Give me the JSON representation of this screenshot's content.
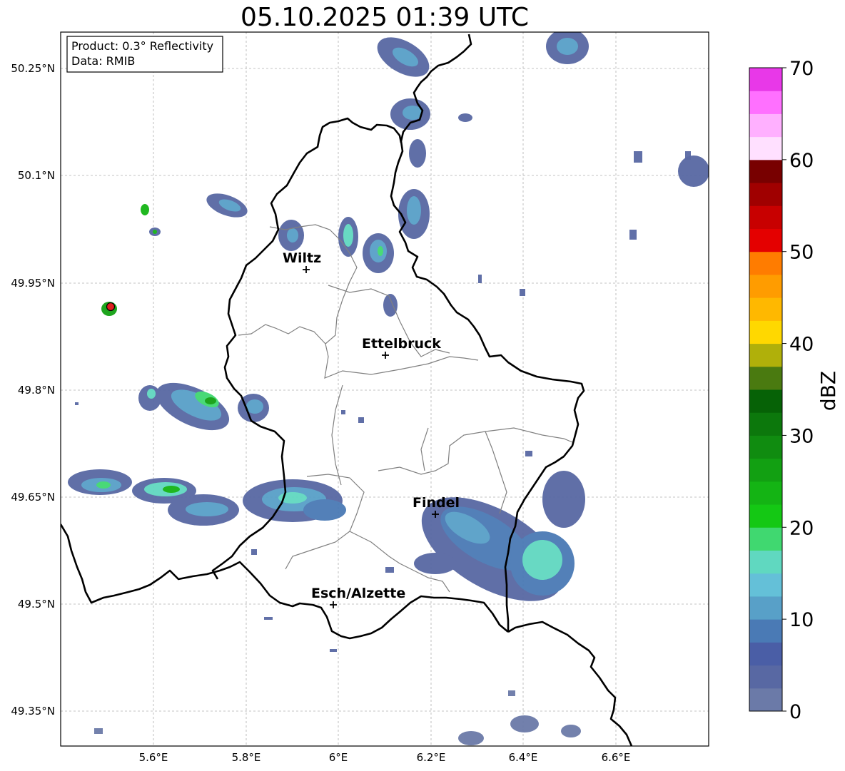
{
  "title": "05.10.2025 01:39 UTC",
  "info_box": {
    "product": "Product: 0.3° Reflectivity",
    "data_source": "Data: RMIB"
  },
  "axes": {
    "lon_ticks": [
      "5.6°E",
      "5.8°E",
      "6°E",
      "6.2°E",
      "6.4°E",
      "6.6°E"
    ],
    "lat_ticks": [
      "50.25°N",
      "50.1°N",
      "49.95°N",
      "49.8°N",
      "49.65°N",
      "49.5°N",
      "49.35°N"
    ]
  },
  "cities": [
    {
      "name": "Wiltz"
    },
    {
      "name": "Ettelbruck"
    },
    {
      "name": "Findel"
    },
    {
      "name": "Esch/Alzette"
    }
  ],
  "colorbar": {
    "title": "dBZ",
    "ticks": [
      "0",
      "10",
      "20",
      "30",
      "40",
      "50",
      "60",
      "70"
    ],
    "colors": [
      "#6b7aa8",
      "#5868a3",
      "#4a5ea6",
      "#4a7ab5",
      "#58a0c8",
      "#64c0d8",
      "#60d8c0",
      "#40d870",
      "#14c814",
      "#14b414",
      "#12a012",
      "#108c10",
      "#0c780c",
      "#066206",
      "#4a7a10",
      "#b0b00a",
      "#ffd800",
      "#ffb800",
      "#ff9c00",
      "#ff7c00",
      "#e40000",
      "#c80000",
      "#a00000",
      "#780000",
      "#ffe0ff",
      "#ffb0ff",
      "#ff70ff",
      "#e838e8"
    ]
  },
  "colors": {
    "border": "#000000",
    "district": "#808080",
    "grid": "#b0b0b0",
    "radar_marker": "#e02020"
  }
}
